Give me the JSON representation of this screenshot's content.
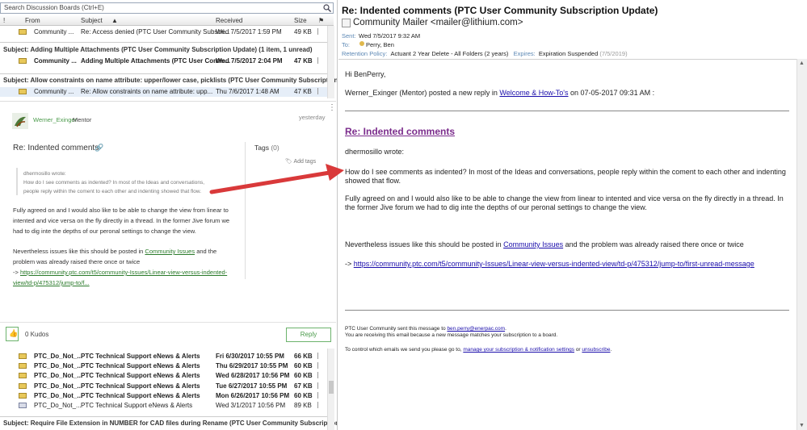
{
  "search": {
    "placeholder": "Search Discussion Boards (Ctrl+E)"
  },
  "columns": {
    "from": "From",
    "subject": "Subject",
    "received": "Received",
    "size": "Size"
  },
  "top_rows": [
    {
      "from": "Community ...",
      "subject": "Re: Access denied (PTC User Community Subscri...",
      "received": "Wed 7/5/2017 1:59 PM",
      "size": "49 KB",
      "bold": false
    }
  ],
  "groups": [
    {
      "header": "Subject: Adding Multiple Attachments (PTC User Community Subscription Update) (1 item, 1 unread)",
      "rows": [
        {
          "from": "Community ...",
          "subject": "Adding Multiple Attachments (PTC User Comm...",
          "received": "Wed 7/5/2017 2:04 PM",
          "size": "47 KB",
          "bold": true
        }
      ]
    },
    {
      "header": "Subject: Allow constraints on name attribute: upper/lower case, picklists (PTC User Community Subscription ...",
      "rows": [
        {
          "from": "Community ...",
          "subject": "Re: Allow constraints on name attribute: upp...",
          "received": "Thu 7/6/2017 1:48 AM",
          "size": "47 KB",
          "bold": false
        }
      ]
    }
  ],
  "post": {
    "author": "Werner_Exinger",
    "role": "Mentor",
    "time": "yesterday",
    "title": "Re: Indented comments",
    "tags_label": "Tags",
    "tags_count": "(0)",
    "add_tags": "Add tags",
    "quote_author": "dhermosillo wrote:",
    "quote_line1": "How do I see comments as indented?  In most of the Ideas and conversations,",
    "quote_line2": "people reply within the coment to each other and indenting showed that flow.",
    "para1_l1": "Fully agreed on and I would also like to be able to change the view from linear to",
    "para1_l2": "intented and vice versa on the fly directly in a thread. In the former Jive forum we",
    "para1_l3": "had to dig inte the depths of our peronal settings to change the view.",
    "para2_pre": "Nevertheless issues like this should be posted in ",
    "para2_link": "Community Issues",
    "para2_post": " and the",
    "para2_l2": "problem was already raised there once or twice",
    "arrow": "-> ",
    "url_l1": "https://community.ptc.com/t5/community-Issues/Linear-view-versus-indented-",
    "url_l2": "view/td-p/475312/jump-to/f...",
    "kudos": "0 Kudos",
    "reply": "Reply"
  },
  "bottom_rows": [
    {
      "from": "PTC_Do_Not_...",
      "subject": "PTC Technical Support eNews & Alerts",
      "received": "Fri 6/30/2017 10:55 PM",
      "size": "66 KB",
      "bold": true
    },
    {
      "from": "PTC_Do_Not_...",
      "subject": "PTC Technical Support eNews & Alerts",
      "received": "Thu 6/29/2017 10:55 PM",
      "size": "60 KB",
      "bold": true
    },
    {
      "from": "PTC_Do_Not_...",
      "subject": "PTC Technical Support eNews & Alerts",
      "received": "Wed 6/28/2017 10:56 PM",
      "size": "60 KB",
      "bold": true
    },
    {
      "from": "PTC_Do_Not_...",
      "subject": "PTC Technical Support eNews & Alerts",
      "received": "Tue 6/27/2017 10:55 PM",
      "size": "67 KB",
      "bold": true
    },
    {
      "from": "PTC_Do_Not_...",
      "subject": "PTC Technical Support eNews & Alerts",
      "received": "Mon 6/26/2017 10:56 PM",
      "size": "60 KB",
      "bold": true
    },
    {
      "from": "PTC_Do_Not_...",
      "subject": "PTC Technical Support eNews & Alerts",
      "received": "Wed 3/1/2017 10:56 PM",
      "size": "89 KB",
      "bold": false
    }
  ],
  "bottom_group": "Subject: Require File Extension in NUMBER for CAD files during Rename (PTC User Community Subscription ...",
  "email": {
    "subject": "Re: Indented comments (PTC User Community Subscription Update)",
    "sender": "Community Mailer <mailer@lithium.com>",
    "sent_label": "Sent:",
    "sent": "Wed 7/5/2017 9:32 AM",
    "to_label": "To:",
    "to": "Perry, Ben",
    "retention_label": "Retention Policy:",
    "retention": "Actuant 2 Year Delete - All Folders (2 years)",
    "expires_label": "Expires:",
    "expires": "Expiration Suspended",
    "expires_date": "(7/5/2019)",
    "greeting": "Hi BenPerry,",
    "intro_pre": "Werner_Exinger (Mentor) posted a new reply in ",
    "intro_link": "Welcome & How-To's",
    "intro_post": " on 07-05-2017 09:31 AM :",
    "title": "Re: Indented comments",
    "wrote": "dhermosillo wrote:",
    "quote_l1": "How do I see comments as indented?  In most of the Ideas and conversations, people reply within the coment to each other and indenting",
    "quote_l2": "showed that flow.",
    "p1_l1": "Fully agreed on and I would also like to be able to change the view from linear to intented and vice versa on the fly directly in a thread.  In",
    "p1_l2": "the former Jive forum we had to dig inte the depths of our peronal settings to change the view.",
    "p2_pre": "Nevertheless issues like this should be posted in ",
    "p2_link": "Community Issues",
    "p2_post": " and the problem was already raised there once or twice",
    "arrow": "-> ",
    "url": "https://community.ptc.com/t5/community-Issues/Linear-view-versus-indented-view/td-p/475312/jump-to/first-unread-message",
    "f1_pre": "PTC User Community sent this message to ",
    "f1_link": "ben.perry@enerpac.com",
    "f1_post": ".",
    "f2": "You are receiving this email because a new message matches your subscription to a board.",
    "f3_pre": "To control which emails we send you please go to, ",
    "f3_link": "manage your subscription & notification settings",
    "f3_mid": " or ",
    "f3_link2": "unsubscribe",
    "f3_post": "."
  },
  "colors": {
    "accent": "#7b2c8c",
    "link_blue": "#1a0dab",
    "green": "#4a9a4a",
    "arrow": "#d9393a"
  }
}
